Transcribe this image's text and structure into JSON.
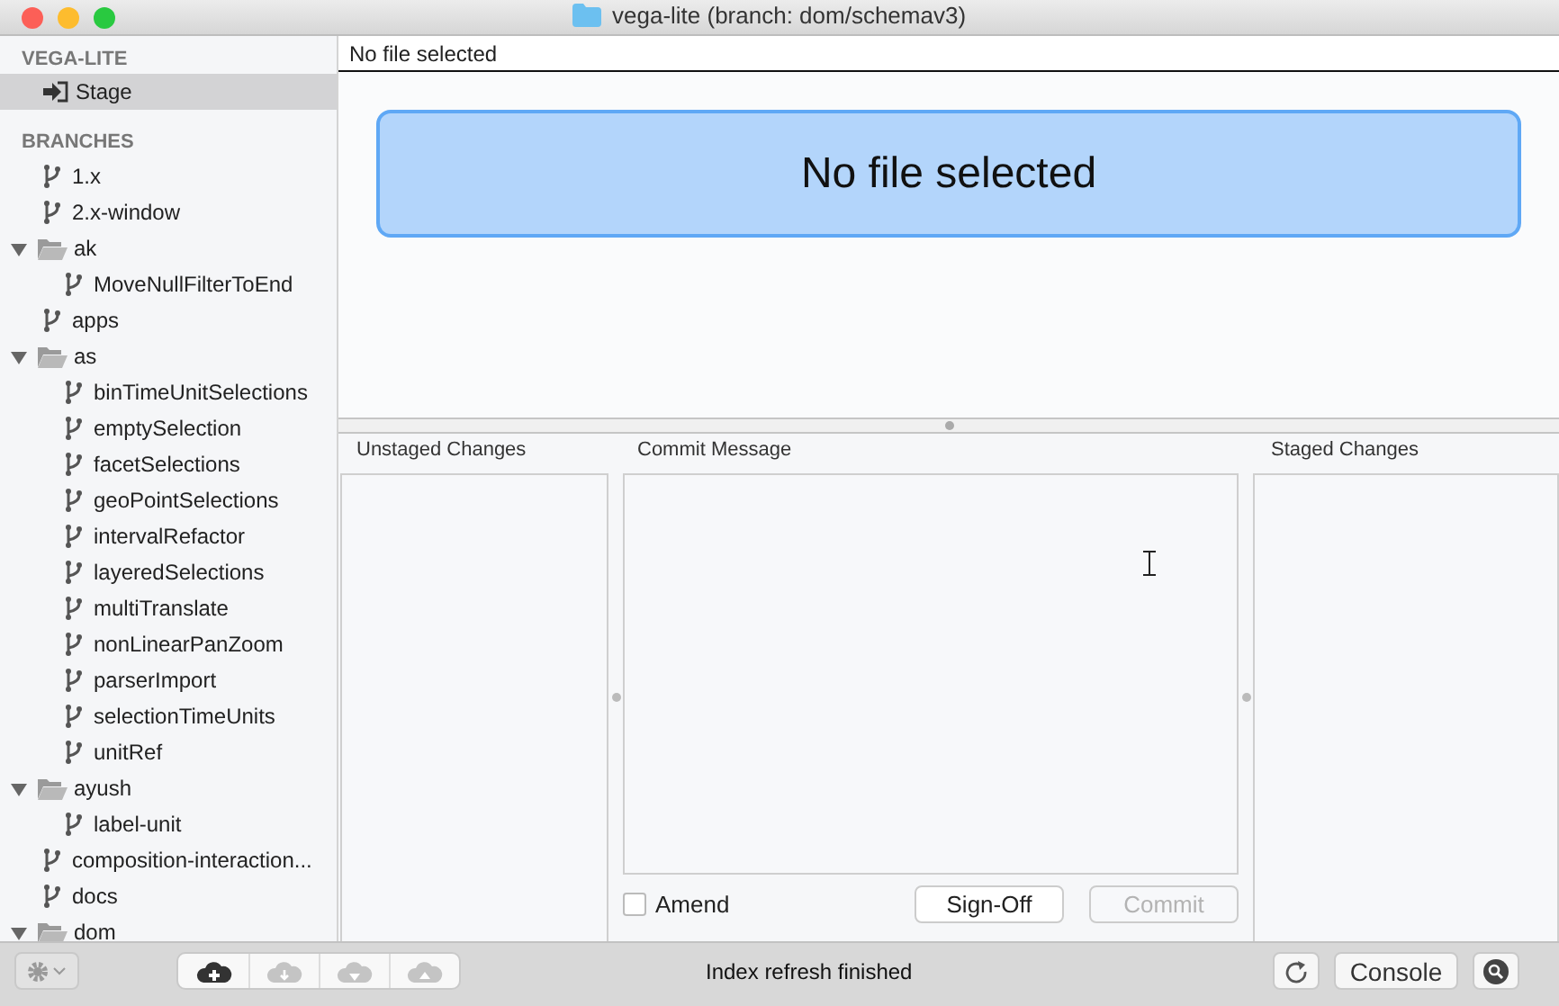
{
  "window": {
    "title": "vega-lite (branch: dom/schemav3)"
  },
  "sidebar": {
    "repo_heading": "VEGA-LITE",
    "stage": {
      "label": "Stage",
      "selected": true
    },
    "branches_heading": "BRANCHES",
    "branches": [
      {
        "kind": "branch",
        "label": "1.x"
      },
      {
        "kind": "branch",
        "label": "2.x-window"
      },
      {
        "kind": "folder",
        "label": "ak",
        "expanded": true,
        "children": [
          {
            "kind": "branch",
            "label": "MoveNullFilterToEnd"
          }
        ]
      },
      {
        "kind": "branch",
        "label": "apps"
      },
      {
        "kind": "folder",
        "label": "as",
        "expanded": true,
        "children": [
          {
            "kind": "branch",
            "label": "binTimeUnitSelections"
          },
          {
            "kind": "branch",
            "label": "emptySelection"
          },
          {
            "kind": "branch",
            "label": "facetSelections"
          },
          {
            "kind": "branch",
            "label": "geoPointSelections"
          },
          {
            "kind": "branch",
            "label": "intervalRefactor"
          },
          {
            "kind": "branch",
            "label": "layeredSelections"
          },
          {
            "kind": "branch",
            "label": "multiTranslate"
          },
          {
            "kind": "branch",
            "label": "nonLinearPanZoom"
          },
          {
            "kind": "branch",
            "label": "parserImport"
          },
          {
            "kind": "branch",
            "label": "selectionTimeUnits"
          },
          {
            "kind": "branch",
            "label": "unitRef"
          }
        ]
      },
      {
        "kind": "folder",
        "label": "ayush",
        "expanded": true,
        "children": [
          {
            "kind": "branch",
            "label": "label-unit"
          }
        ]
      },
      {
        "kind": "branch",
        "label": "composition-interaction..."
      },
      {
        "kind": "branch",
        "label": "docs"
      },
      {
        "kind": "folder",
        "label": "dom",
        "expanded": true
      }
    ]
  },
  "diff": {
    "header": "No file selected",
    "banner": "No file selected"
  },
  "commit": {
    "unstaged_title": "Unstaged Changes",
    "message_title": "Commit Message",
    "staged_title": "Staged Changes",
    "amend": {
      "label": "Amend",
      "checked": false
    },
    "buttons": [
      {
        "label": "Sign-Off",
        "disabled": false
      },
      {
        "label": "Commit",
        "disabled": true
      }
    ]
  },
  "toolbar": {
    "remote_buttons": [
      {
        "kind": "add",
        "disabled": false
      },
      {
        "kind": "fetch",
        "disabled": true
      },
      {
        "kind": "pull",
        "disabled": true
      },
      {
        "kind": "push",
        "disabled": true
      }
    ],
    "status": "Index refresh finished",
    "console": "Console"
  }
}
